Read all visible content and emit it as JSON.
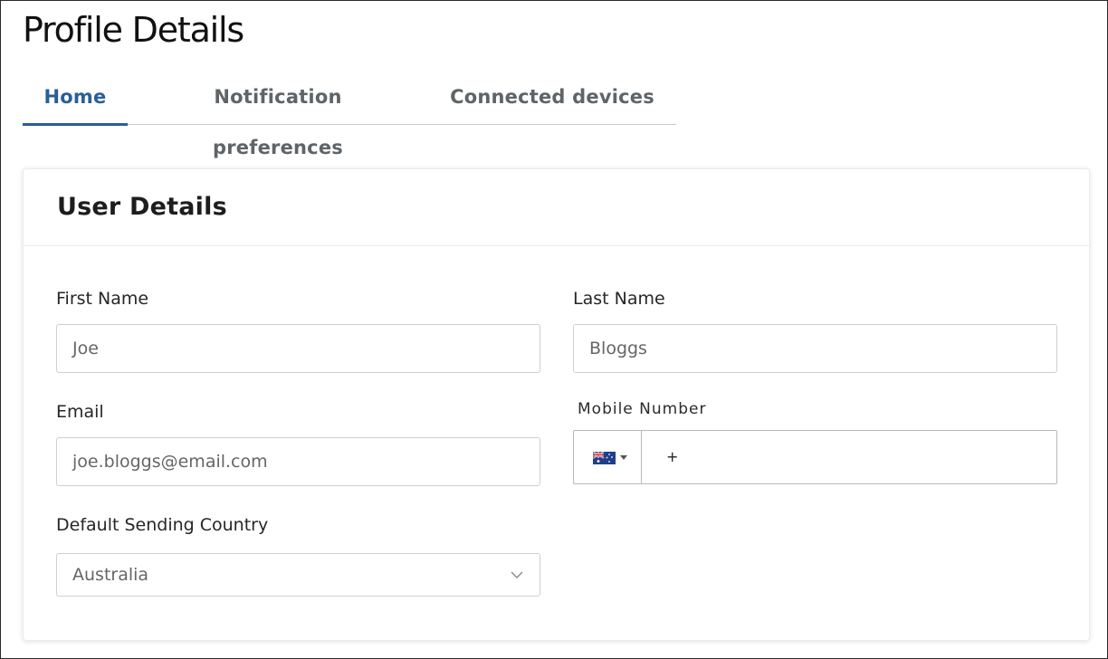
{
  "page": {
    "title": "Profile Details"
  },
  "tabs": [
    {
      "label": "Home",
      "active": true
    },
    {
      "label": "Notification preferences",
      "active": false
    },
    {
      "label": "Connected devices",
      "active": false
    }
  ],
  "card": {
    "title": "User Details",
    "fields": {
      "first_name": {
        "label": "First Name",
        "value": "Joe"
      },
      "last_name": {
        "label": "Last Name",
        "value": "Bloggs"
      },
      "email": {
        "label": "Email",
        "value": "joe.bloggs@email.com"
      },
      "mobile": {
        "label": "Mobile Number",
        "country_flag": "australia-flag-icon",
        "prefix": "+"
      },
      "default_country": {
        "label": "Default Sending Country",
        "value": "Australia",
        "icon": "chevron-down-icon"
      }
    }
  },
  "colors": {
    "accent": "#2a5f97",
    "tab_inactive": "#5e6468",
    "border": "#cfcfcf"
  }
}
